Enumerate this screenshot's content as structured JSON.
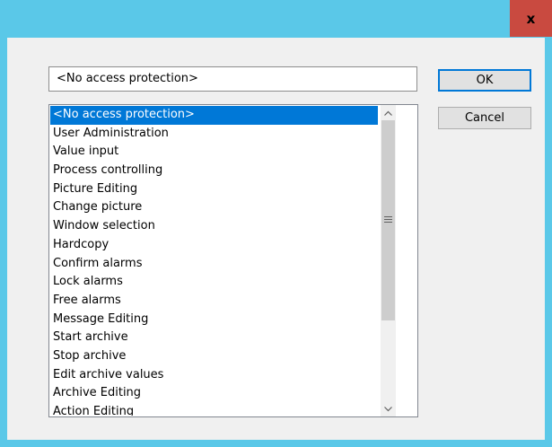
{
  "titlebar": {
    "close_glyph": "x"
  },
  "access_field": {
    "value": "<No access protection>"
  },
  "buttons": {
    "ok": "OK",
    "cancel": "Cancel"
  },
  "list": {
    "items": [
      "<No access protection>",
      "User Administration",
      "Value input",
      "Process controlling",
      "Picture Editing",
      "Change picture",
      "Window selection",
      "Hardcopy",
      "Confirm alarms",
      "Lock alarms",
      "Free alarms",
      "Message Editing",
      "Start archive",
      "Stop archive",
      "Edit archive values",
      "Archive Editing",
      "Action Editing"
    ],
    "selected_index": 0
  },
  "colors": {
    "titlebar": "#5ac8e8",
    "close_button": "#c94a40",
    "selection": "#0078d7"
  },
  "icons": {
    "close": "close-icon",
    "scroll_up": "chevron-up-icon",
    "scroll_down": "chevron-down-icon",
    "thumb_grip": "grip-icon"
  }
}
